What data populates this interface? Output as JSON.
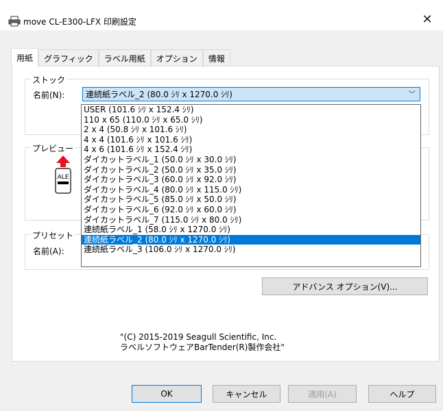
{
  "window": {
    "title": "move CL-E300-LFX 印刷設定",
    "close_icon": "close-icon",
    "printer_icon": "printer-icon"
  },
  "tabs": [
    {
      "label": "用紙",
      "active": true
    },
    {
      "label": "グラフィック",
      "active": false
    },
    {
      "label": "ラベル用紙",
      "active": false
    },
    {
      "label": "オプション",
      "active": false
    },
    {
      "label": "情報",
      "active": false
    }
  ],
  "stock": {
    "group_label": "ストック",
    "name_label": "名前(N):",
    "selected_value": "連続紙ラベル_2 (80.0 ｼﾘ x 1270.0 ｼﾘ)",
    "options": [
      "USER (101.6 ｼﾘ x 152.4 ｼﾘ)",
      "110 x 65 (110.0 ｼﾘ x 65.0 ｼﾘ)",
      "2 x 4 (50.8 ｼﾘ x 101.6 ｼﾘ)",
      "4 x 4 (101.6 ｼﾘ x 101.6 ｼﾘ)",
      "4 x 6 (101.6 ｼﾘ x 152.4 ｼﾘ)",
      "ダイカットラベル_1 (50.0 ｼﾘ x 30.0 ｼﾘ)",
      "ダイカットラベル_2 (50.0 ｼﾘ x 35.0 ｼﾘ)",
      "ダイカットラベル_3 (60.0 ｼﾘ x 92.0 ｼﾘ)",
      "ダイカットラベル_4 (80.0 ｼﾘ x 115.0 ｼﾘ)",
      "ダイカットラベル_5 (85.0 ｼﾘ x 50.0 ｼﾘ)",
      "ダイカットラベル_6 (92.0 ｼﾘ x 60.0 ｼﾘ)",
      "ダイカットラベル_7 (115.0 ｼﾘ x 80.0 ｼﾘ)",
      "連続紙ラベル_1 (58.0 ｼﾘ x 1270.0 ｼﾘ)",
      "連続紙ラベル_2 (80.0 ｼﾘ x 1270.0 ｼﾘ)",
      "連続紙ラベル_3 (106.0 ｼﾘ x 1270.0 ｼﾘ)"
    ],
    "selected_index": 13
  },
  "preview": {
    "group_label": "プレビュー",
    "label_text": "ALE"
  },
  "preset": {
    "group_label": "プリセット",
    "name_label": "名前(A):"
  },
  "advanced_button": "アドバンス オプション(V)...",
  "copyright": {
    "line1": "\"(C) 2015-2019 Seagull Scientific, Inc.",
    "line2": "ラベルソフトウェアBarTender(R)製作会社\""
  },
  "buttons": {
    "ok": "OK",
    "cancel": "キャンセル",
    "apply": "適用(A)",
    "help": "ヘルプ"
  }
}
